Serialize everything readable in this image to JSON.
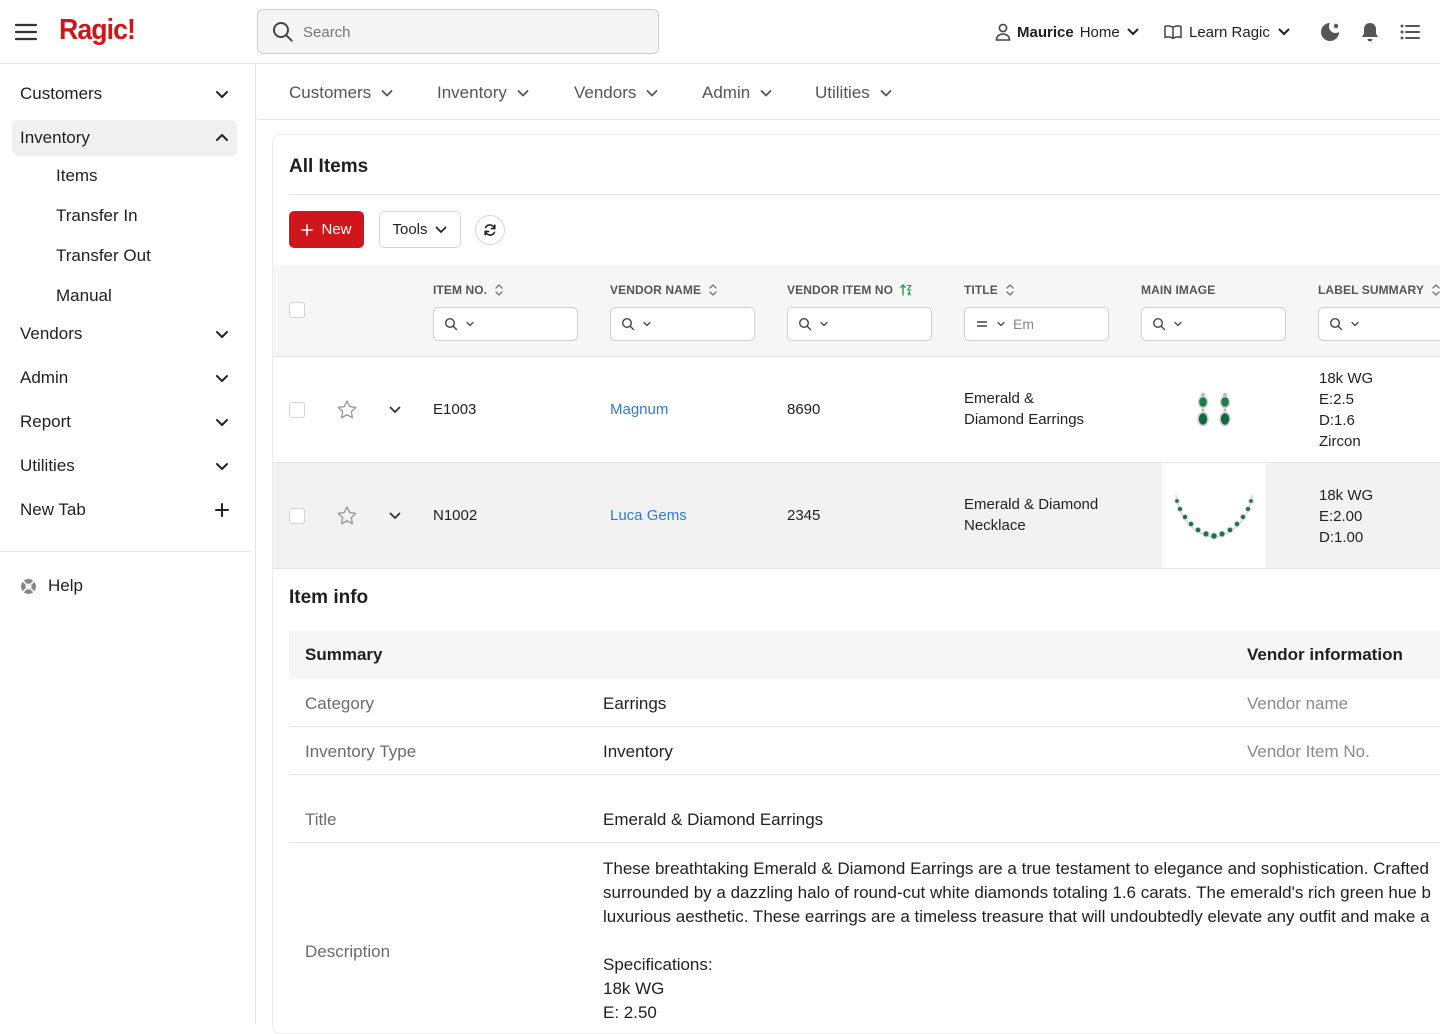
{
  "app": {
    "logo": "Ragic!",
    "brand_color": "#d0161b"
  },
  "topbar": {
    "search_placeholder": "Search",
    "user_name": "Maurice",
    "user_suffix": "Home",
    "learn_label": "Learn Ragic",
    "icons": [
      "hamburger-icon",
      "search-icon",
      "user-icon",
      "book-icon",
      "theme-icon",
      "bell-icon",
      "list-icon"
    ]
  },
  "sidebar": {
    "items": [
      {
        "label": "Customers"
      },
      {
        "label": "Inventory",
        "expanded": true
      },
      {
        "label": "Vendors"
      },
      {
        "label": "Admin"
      },
      {
        "label": "Report"
      },
      {
        "label": "Utilities"
      },
      {
        "label": "New Tab"
      }
    ],
    "inventory_sub": [
      "Items",
      "Transfer In",
      "Transfer Out",
      "Manual"
    ],
    "help": "Help"
  },
  "tabs": [
    "Customers",
    "Inventory",
    "Vendors",
    "Admin",
    "Utilities"
  ],
  "list": {
    "title": "All Items",
    "new_label": "New",
    "tools_label": "Tools",
    "columns": [
      "ITEM NO.",
      "VENDOR NAME",
      "VENDOR ITEM NO",
      "TITLE",
      "MAIN IMAGE",
      "LABEL SUMMARY"
    ],
    "title_filter_value": "Em",
    "rows": [
      {
        "item_no": "E1003",
        "vendor_name": "Magnum",
        "vendor_item_no": "8690",
        "title": [
          "Emerald &",
          "Diamond Earrings"
        ],
        "label_summary": [
          "18k WG",
          "E:2.5",
          "D:1.6",
          "Zircon"
        ]
      },
      {
        "item_no": "N1002",
        "vendor_name": "Luca Gems",
        "vendor_item_no": "2345",
        "title": [
          "Emerald & Diamond",
          "Necklace"
        ],
        "label_summary": [
          "18k WG",
          "E:2.00",
          "D:1.00"
        ]
      }
    ]
  },
  "item_info": {
    "title": "Item info",
    "summary_heading": "Summary",
    "vendor_heading": "Vendor information",
    "fields": [
      {
        "label": "Category",
        "value": "Earrings",
        "vendor_label": "Vendor name"
      },
      {
        "label": "Inventory Type",
        "value": "Inventory",
        "vendor_label": "Vendor Item No."
      },
      {
        "label": "Title",
        "value": "Emerald & Diamond Earrings"
      }
    ],
    "description_label": "Description",
    "description_lines": [
      "These breathtaking Emerald & Diamond Earrings are a true testament to elegance and sophistication. Crafted",
      "surrounded by a dazzling halo of round-cut white diamonds totaling 1.6 carats. The emerald's rich green hue b",
      "luxurious aesthetic. These earrings are a timeless treasure that will undoubtedly elevate any outfit and make a"
    ],
    "spec_lines": [
      "Specifications:",
      "18k WG",
      "E: 2.50"
    ]
  }
}
